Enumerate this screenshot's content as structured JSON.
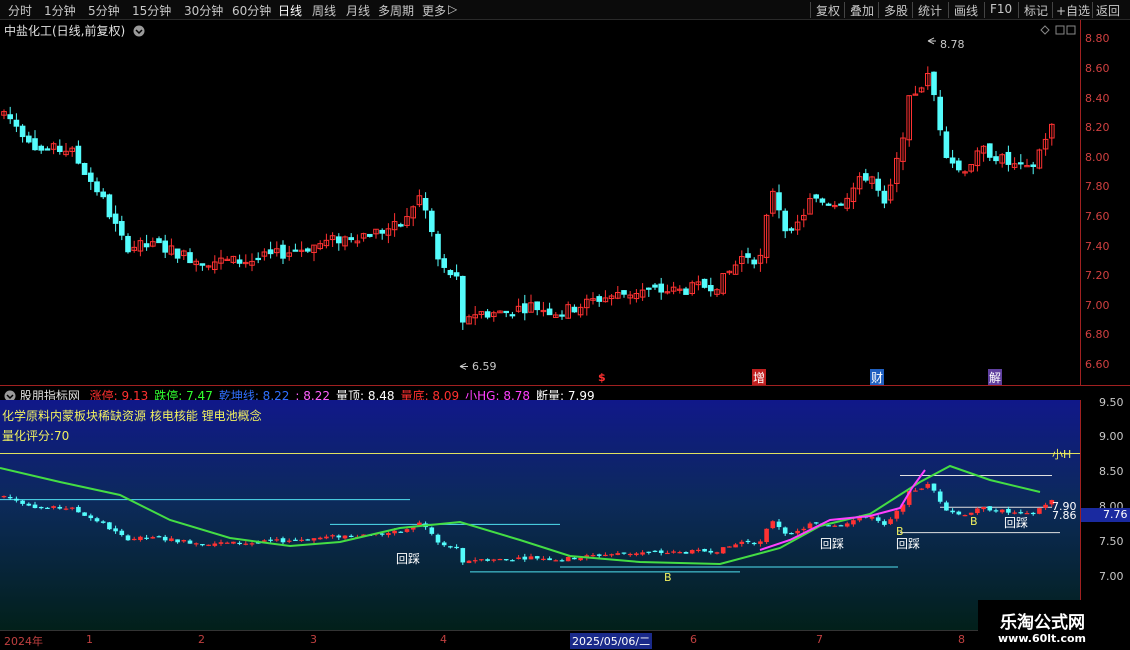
{
  "toolbar": {
    "periods": [
      "分时",
      "1分钟",
      "5分钟",
      "15分钟",
      "30分钟",
      "60分钟",
      "日线",
      "周线",
      "月线",
      "多周期",
      "更多"
    ],
    "active_period": "日线",
    "more_arrow": "▷",
    "right_buttons": [
      "复权",
      "叠加",
      "多股",
      "统计",
      "画线",
      "F10",
      "标记",
      "+自选",
      "返回"
    ]
  },
  "stock": {
    "name": "中盐化工(日线,前复权)"
  },
  "price_axis": [
    "8.80",
    "8.60",
    "8.40",
    "8.20",
    "8.00",
    "7.80",
    "7.60",
    "7.40",
    "7.20",
    "7.00",
    "6.80",
    "6.60"
  ],
  "price_marks": {
    "high": "8.78",
    "low": "6.59"
  },
  "event_markers": [
    "$",
    "增",
    "财",
    "解"
  ],
  "indicator": {
    "name": "股朋指标网",
    "items": [
      {
        "label": "涨停:",
        "value": "9.13",
        "color": "#ff3030"
      },
      {
        "label": "跌停:",
        "value": "7.47",
        "color": "#30ff30"
      },
      {
        "label": "乾坤线:",
        "value": "8.22",
        "color": "#3070ff"
      },
      {
        "label": ":",
        "value": "8.22",
        "color": "#ff60ff"
      },
      {
        "label": "量顶:",
        "value": "8.48",
        "color": "#ffffff"
      },
      {
        "label": "量底:",
        "value": "8.09",
        "color": "#ff3030"
      },
      {
        "label": "小HG:",
        "value": "8.78",
        "color": "#ff40ff"
      },
      {
        "label": "断量:",
        "value": "7.99",
        "color": "#ffffff"
      }
    ],
    "concepts": "化学原料内蒙板块稀缺资源 核电核能 锂电池概念",
    "score": "量化评分:70",
    "small_h": "小H",
    "right_values": [
      "7.90",
      "7.86"
    ],
    "current_value": "7.76",
    "labels": [
      "回踩",
      "回踩",
      "回踩",
      "回踩",
      "B",
      "B",
      "B"
    ]
  },
  "ind_axis": [
    "9.50",
    "9.00",
    "8.50",
    "8.00",
    "7.50",
    "7.00"
  ],
  "dates": [
    {
      "text": "2024年",
      "hl": false
    },
    {
      "text": "1",
      "hl": false
    },
    {
      "text": "2",
      "hl": false
    },
    {
      "text": "3",
      "hl": false
    },
    {
      "text": "4",
      "hl": false
    },
    {
      "text": "2025/05/06/二",
      "hl": true
    },
    {
      "text": "6",
      "hl": false
    },
    {
      "text": "7",
      "hl": false
    },
    {
      "text": "8",
      "hl": false
    }
  ],
  "watermark": {
    "title": "乐淘公式网",
    "url": "www.60lt.com"
  },
  "colors": {
    "up": "#ff3232",
    "down": "#54fcfc",
    "ma": "#44dd44",
    "bg_main": "#000000"
  }
}
